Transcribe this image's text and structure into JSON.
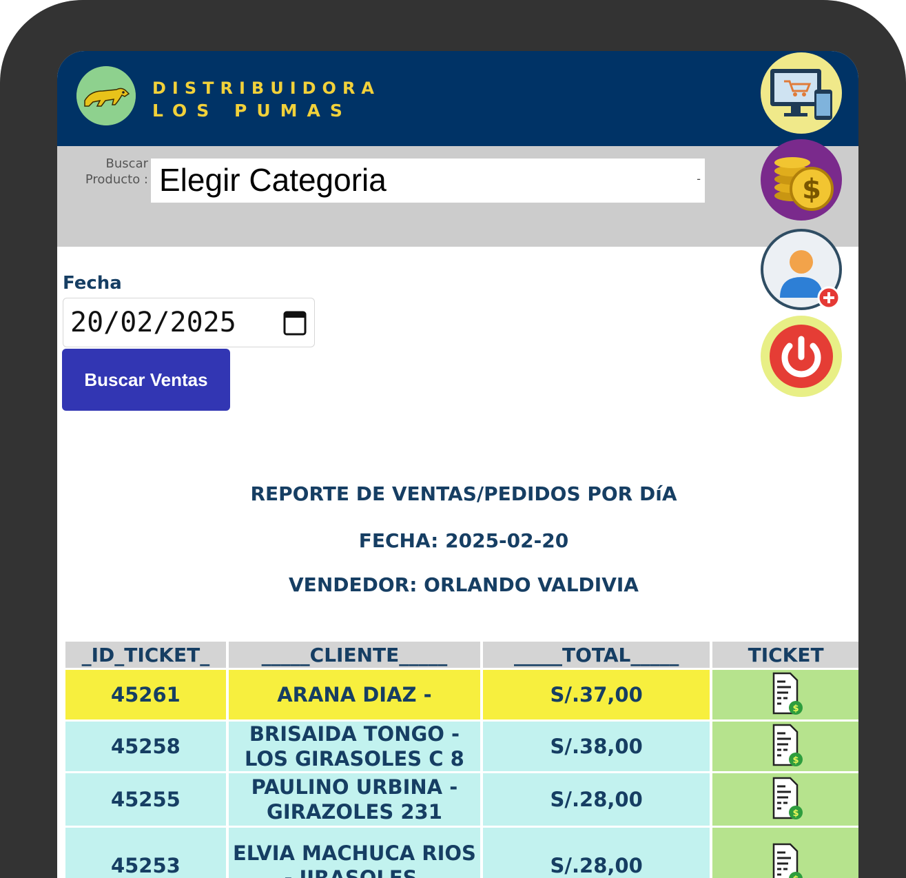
{
  "header": {
    "brand_line1": "DISTRIBUIDORA",
    "brand_line2": "LOS PUMAS",
    "logo_icon": "puma-logo-icon"
  },
  "side_menu": [
    {
      "name": "store-computer-icon",
      "bg": "#f0e98a"
    },
    {
      "name": "coins-dollar-icon",
      "bg": "#7a2a8c"
    },
    {
      "name": "add-user-icon",
      "bg": "#ecf0f4"
    },
    {
      "name": "power-icon",
      "bg": "#e8ef86"
    }
  ],
  "search": {
    "label": "Buscar Producto :",
    "category_value": "Elegir Categoria",
    "arrow": "-"
  },
  "date_filter": {
    "label": "Fecha",
    "value": "20/02/2025",
    "button_label": "Buscar Ventas"
  },
  "report": {
    "title": "REPORTE DE VENTAS/PEDIDOS POR DíA",
    "date_line": "FECHA: 2025-02-20",
    "seller_line": "VENDEDOR: ORLANDO VALDIVIA"
  },
  "table": {
    "headers": [
      "_ID_TICKET_",
      "_____CLIENTE_____",
      "_____TOTAL_____",
      "TICKET"
    ],
    "rows": [
      {
        "id": "45261",
        "client": "ARANA DIAZ -",
        "total": "S/.37,00",
        "highlight": true
      },
      {
        "id": "45258",
        "client": "BRISAIDA TONGO - LOS GIRASOLES C 8",
        "total": "S/.38,00",
        "highlight": false
      },
      {
        "id": "45255",
        "client": "PAULINO URBINA - GIRAZOLES 231",
        "total": "S/.28,00",
        "highlight": false
      },
      {
        "id": "45253",
        "client": "ELVIA MACHUCA RIOS - JIRASOLES,",
        "total": "S/.28,00",
        "highlight": false
      }
    ],
    "ticket_icon": "receipt-dollar-icon"
  },
  "colors": {
    "header_bg": "#003366",
    "brand_text": "#f2d13a",
    "button_bg": "#3236b3",
    "highlight_row": "#f7ef3e",
    "normal_row": "#c2f2ef",
    "ticket_cell": "#b6e38d",
    "title_text": "#163e63"
  }
}
